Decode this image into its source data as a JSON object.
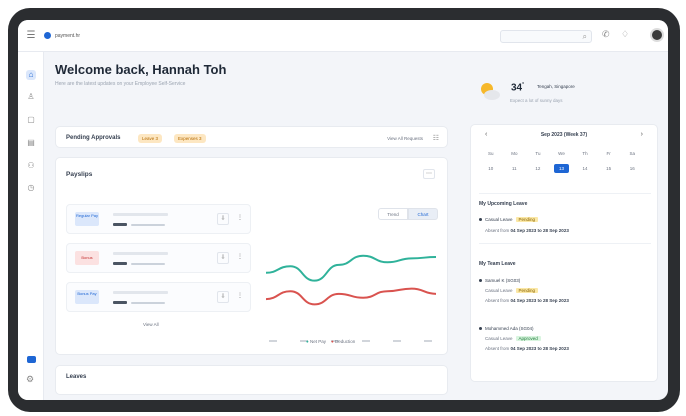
{
  "app": {
    "logo_text": "payment.hr"
  },
  "icons": [
    "menu-icon",
    "search-icon",
    "phone-icon",
    "bell-icon",
    "home-icon",
    "user-icon",
    "document-icon",
    "calendar-icon",
    "team-icon",
    "clock-icon",
    "chat-icon",
    "gear-icon",
    "filter-icon",
    "download-icon",
    "more-icon",
    "weather-icon"
  ],
  "welcome": {
    "title": "Welcome back, Hannah Toh",
    "subtitle": "Here are the latest updates on your Employee Self-Service"
  },
  "pending": {
    "title": "Pending Approvals",
    "pill1": "Leave 3",
    "pill2": "Expenses 3",
    "view_link": "View All Requests"
  },
  "payslips": {
    "title": "Payslips",
    "toggle_trend": "Trend",
    "toggle_chart": "Chart",
    "rows": [
      {
        "badge": "Regular Pay",
        "color": "blue"
      },
      {
        "badge": "Bonus",
        "color": "red"
      },
      {
        "badge": "Bonus Pay",
        "color": "blue"
      }
    ],
    "view_all": "View All",
    "legend": [
      "Net Pay",
      "Deduction"
    ]
  },
  "chart_data": {
    "type": "line",
    "series": [
      {
        "name": "Net Pay",
        "values": [
          42,
          47,
          36,
          48,
          55,
          50,
          53,
          54
        ],
        "color": "#2fb29a"
      },
      {
        "name": "Deduction",
        "values": [
          22,
          28,
          18,
          26,
          23,
          28,
          30,
          26
        ],
        "color": "#d9534f"
      }
    ],
    "ylim": [
      0,
      70
    ],
    "grid": false
  },
  "leaves_card": {
    "title": "Leaves"
  },
  "weather": {
    "temp": "34",
    "unit": "°",
    "location": "Tengah, Singapore",
    "desc": "Expect a lot of sunny days"
  },
  "calendar": {
    "title": "Sep 2023 (Week 37)",
    "prev": "‹",
    "next": "›",
    "days": [
      "Su",
      "Mo",
      "Tu",
      "We",
      "Th",
      "Fr",
      "Sa"
    ],
    "dates": [
      "10",
      "11",
      "12",
      "13",
      "14",
      "15",
      "16"
    ],
    "today_index": 3
  },
  "upcoming": {
    "title": "My Upcoming Leave",
    "type": "Casual Leave",
    "status": "Pending",
    "dates_label": "Absent from",
    "dates": "04 Sep 2023 to 28 Sep 2023"
  },
  "team": {
    "title": "My Team Leave",
    "members": [
      {
        "name": "Samuel K (SG03)",
        "type": "Casual Leave",
        "status": "Pending",
        "status_color": "yellow",
        "dates_label": "Absent from",
        "dates": "04 Sep 2023 to 28 Sep 2023"
      },
      {
        "name": "Mohammed Ada (SG04)",
        "type": "Casual Leave",
        "status": "Approved",
        "status_color": "green",
        "dates_label": "Absent from",
        "dates": "04 Sep 2023 to 28 Sep 2023"
      }
    ]
  }
}
